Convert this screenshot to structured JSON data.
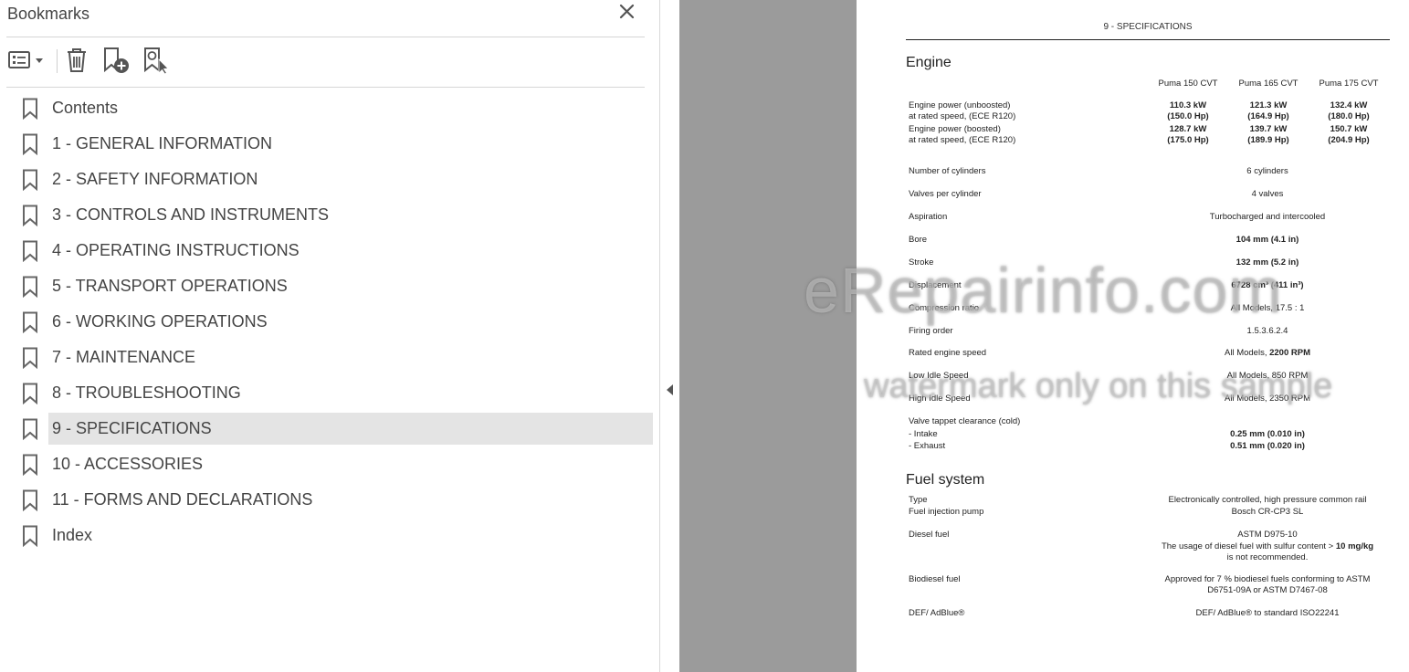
{
  "bookmarks_panel": {
    "title": "Bookmarks",
    "close_icon": "close-icon",
    "toolbar": [
      "options-menu-icon",
      "delete-bookmark-icon",
      "new-bookmark-icon",
      "find-current-bookmark-icon"
    ],
    "items": [
      {
        "label": "Contents"
      },
      {
        "label": "1 - GENERAL INFORMATION"
      },
      {
        "label": "2 - SAFETY INFORMATION"
      },
      {
        "label": "3 - CONTROLS AND INSTRUMENTS"
      },
      {
        "label": "4 - OPERATING INSTRUCTIONS"
      },
      {
        "label": "5 - TRANSPORT OPERATIONS"
      },
      {
        "label": "6 - WORKING OPERATIONS"
      },
      {
        "label": "7 - MAINTENANCE"
      },
      {
        "label": "8 - TROUBLESHOOTING"
      },
      {
        "label": "9 - SPECIFICATIONS",
        "selected": true
      },
      {
        "label": "10 - ACCESSORIES"
      },
      {
        "label": "11 - FORMS AND DECLARATIONS"
      },
      {
        "label": "Index"
      }
    ]
  },
  "document": {
    "header": "9 - SPECIFICATIONS",
    "engine": {
      "title": "Engine",
      "columns": [
        "Puma 150 CVT",
        "Puma 165 CVT",
        "Puma 175 CVT"
      ],
      "power_unboosted": {
        "label1": "Engine power (unboosted)",
        "label2": "at rated speed, (ECE R120)",
        "v": [
          "110.3 kW",
          "121.3 kW",
          "132.4 kW"
        ],
        "hp": [
          "(150.0 Hp)",
          "(164.9 Hp)",
          "(180.0 Hp)"
        ]
      },
      "power_boosted": {
        "label1": "Engine power (boosted)",
        "label2": "at rated speed, (ECE R120)",
        "v": [
          "128.7 kW",
          "139.7 kW",
          "150.7 kW"
        ],
        "hp": [
          "(175.0 Hp)",
          "(189.9 Hp)",
          "(204.9 Hp)"
        ]
      },
      "rows": [
        {
          "label": "Number of cylinders",
          "value": "6 cylinders"
        },
        {
          "label": "Valves per cylinder",
          "value": "4 valves"
        },
        {
          "label": "Aspiration",
          "value": "Turbocharged and intercooled"
        },
        {
          "label": "Bore",
          "value": "104 mm (4.1 in)"
        },
        {
          "label": "Stroke",
          "value": "132 mm (5.2 in)"
        },
        {
          "label": "Displacement",
          "value": "6728 cm³ (411 in³)"
        },
        {
          "label": "Compression ratio",
          "value": "All Models, 17.5 : 1"
        },
        {
          "label": "Firing order",
          "value": "1.5.3.6.2.4"
        },
        {
          "label": "Rated engine speed",
          "value_pre": "All Models, ",
          "value_bold": "2200 RPM"
        },
        {
          "label": "Low Idle Speed",
          "value": "All Models, 850 RPM"
        },
        {
          "label": "High Idle Speed",
          "value": "All Models, 2350 RPM"
        }
      ],
      "valve": {
        "label": "Valve tappet clearance (cold)",
        "intake_label": "- Intake",
        "intake": "0.25 mm (0.010 in)",
        "exhaust_label": "- Exhaust",
        "exhaust": "0.51 mm (0.020 in)"
      }
    },
    "fuel": {
      "title": "Fuel system",
      "type_label": "Type",
      "type_value": "Electronically controlled, high pressure common rail",
      "pump_label": "Fuel injection pump",
      "pump_value": "Bosch CR-CP3 SL",
      "diesel_label": "Diesel fuel",
      "diesel_v1": "ASTM D975-10",
      "diesel_v2_pre": "The usage of diesel fuel with sulfur content > ",
      "diesel_v2_bold": "10 mg/kg",
      "diesel_v3": "is not recommended.",
      "bio_label": "Biodiesel fuel",
      "bio_v1": "Approved for 7 % biodiesel fuels conforming to ASTM",
      "bio_v2": "D6751-09A or ASTM D7467-08",
      "def_label": "DEF/ AdBlue®",
      "def_value": "DEF/ AdBlue® to standard ISO22241"
    },
    "watermark": {
      "line1": "eRepairinfo.com",
      "line2": "watermark only on this sample"
    }
  }
}
